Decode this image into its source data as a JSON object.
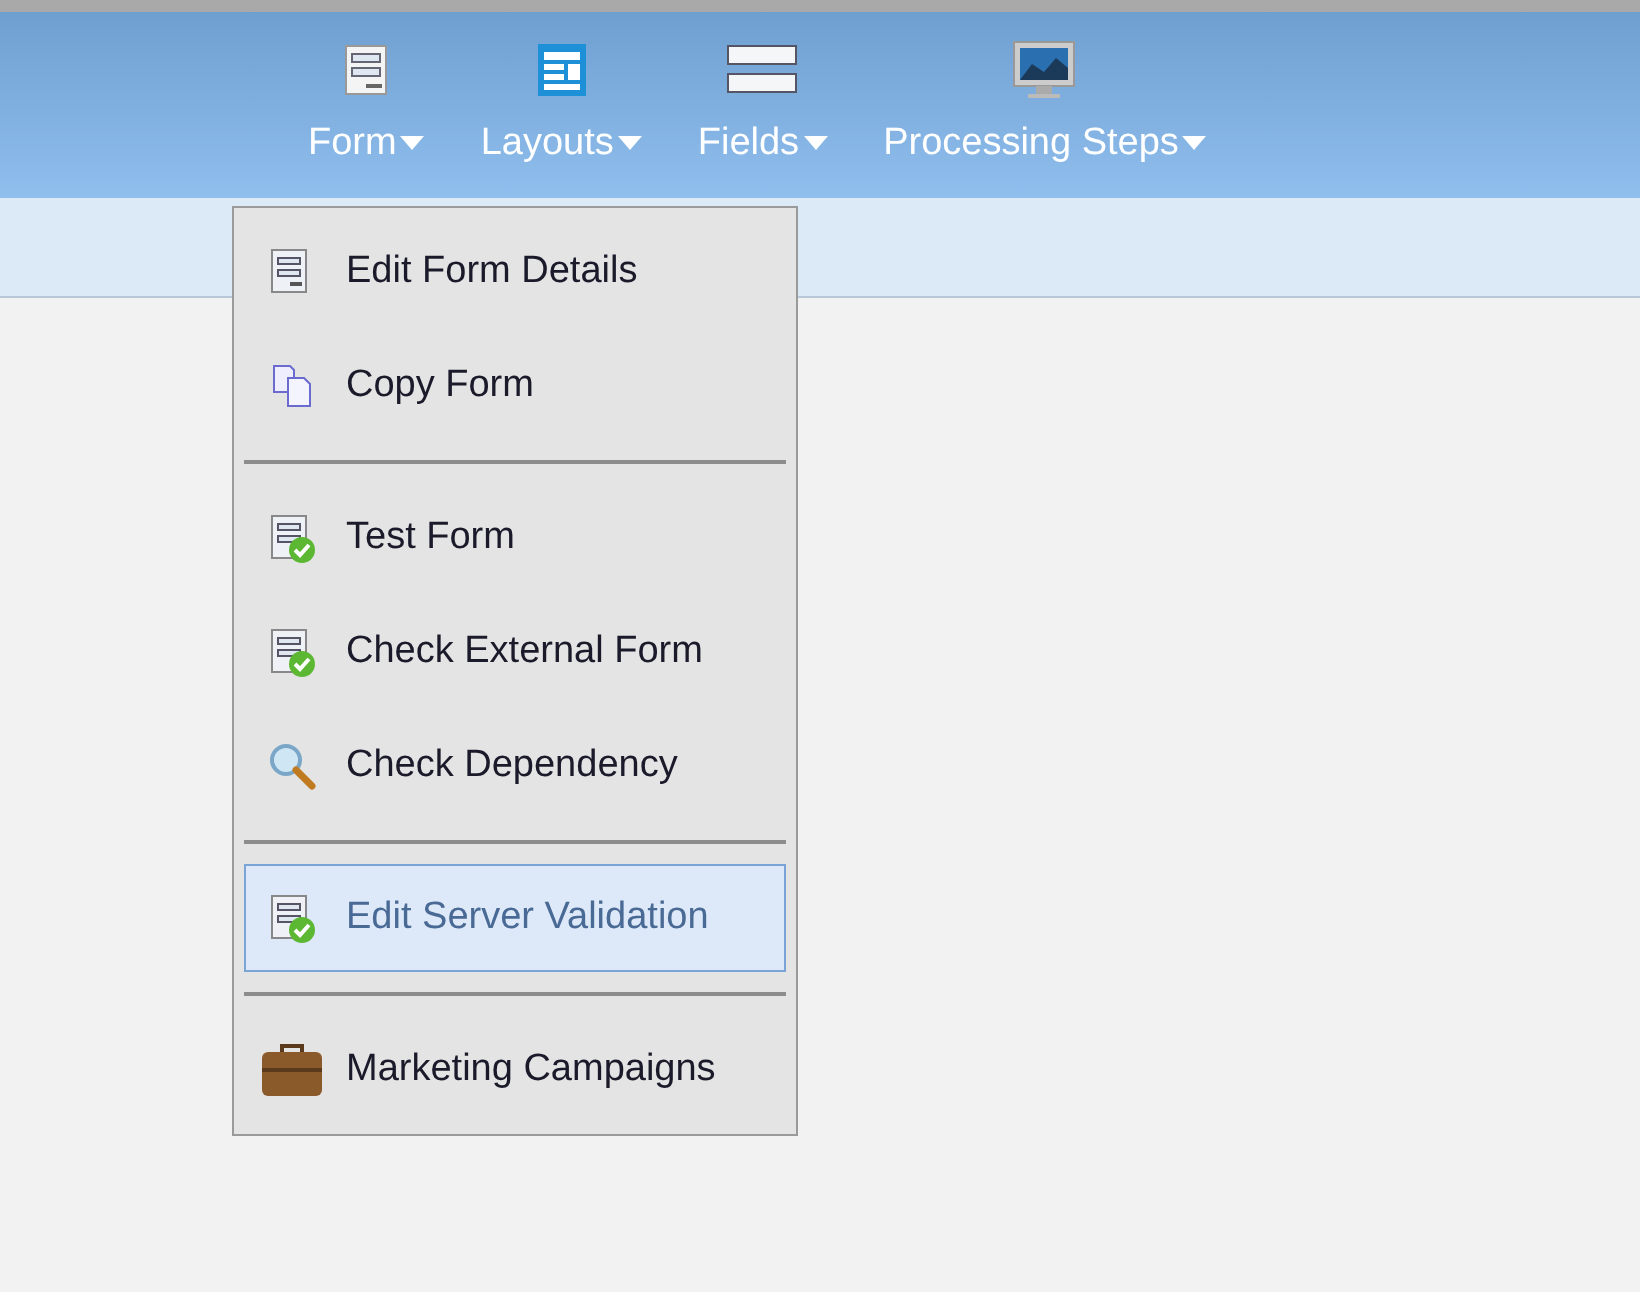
{
  "toolbar": [
    {
      "label": "Form"
    },
    {
      "label": "Layouts"
    },
    {
      "label": "Fields"
    },
    {
      "label": "Processing Steps"
    }
  ],
  "menu": {
    "groups": [
      {
        "items": [
          {
            "label": "Edit Form Details",
            "selected": false
          },
          {
            "label": "Copy Form",
            "selected": false
          }
        ]
      },
      {
        "items": [
          {
            "label": "Test Form",
            "selected": false
          },
          {
            "label": "Check External Form",
            "selected": false
          },
          {
            "label": "Check Dependency",
            "selected": false
          }
        ]
      },
      {
        "items": [
          {
            "label": "Edit Server Validation",
            "selected": true
          }
        ]
      },
      {
        "items": [
          {
            "label": "Marketing Campaigns",
            "selected": false
          }
        ]
      }
    ]
  }
}
